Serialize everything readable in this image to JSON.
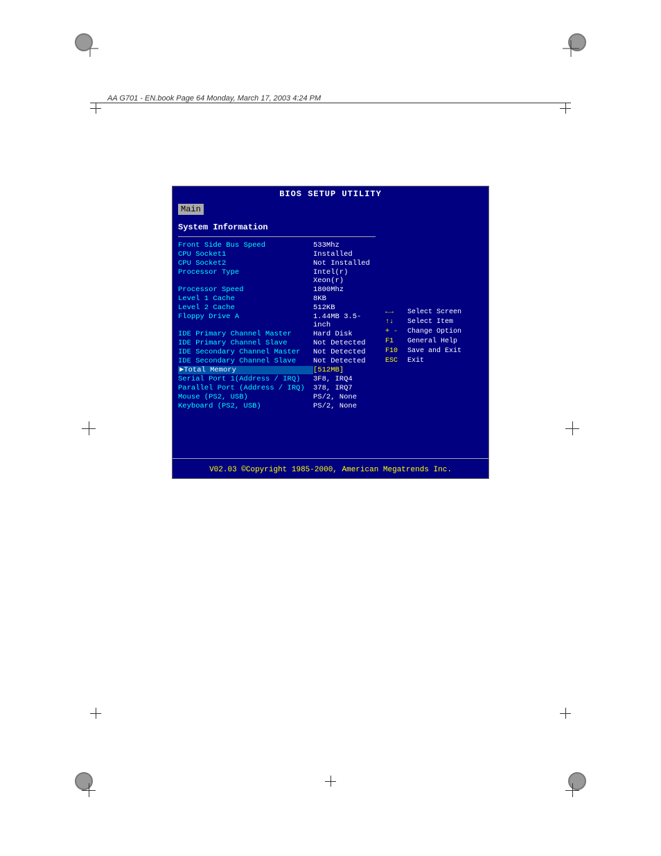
{
  "page": {
    "header_text": "AA G701 - EN.book  Page 64  Monday, March 17, 2003  4:24 PM"
  },
  "bios": {
    "title": "BIOS SETUP UTILITY",
    "menu_items": [
      "Main"
    ],
    "active_menu": "Main",
    "section_title": "System Information",
    "rows": [
      {
        "label": "Front Side Bus Speed",
        "value": "533Mhz"
      },
      {
        "label": "CPU Socket1",
        "value": "Installed"
      },
      {
        "label": "CPU Socket2",
        "value": "Not Installed"
      },
      {
        "label": "Processor Type",
        "value": "Intel(r)   Xeon(r)"
      },
      {
        "label": "Processor Speed",
        "value": "1800Mhz"
      },
      {
        "label": "Level 1 Cache",
        "value": "8KB"
      },
      {
        "label": "Level 2 Cache",
        "value": "512KB"
      },
      {
        "label": "Floppy Drive A",
        "value": "1.44MB   3.5-inch"
      },
      {
        "label": "IDE Primary Channel Master",
        "value": "Hard Disk"
      },
      {
        "label": "IDE Primary Channel Slave",
        "value": "Not Detected"
      },
      {
        "label": "IDE Secondary Channel Master",
        "value": "Not Detected"
      },
      {
        "label": "IDE Secondary Channel Slave",
        "value": "Not Detected"
      },
      {
        "label": "►Total Memory",
        "value": "[512MB]",
        "highlight": true
      },
      {
        "label": "Serial Port 1(Address / IRQ)",
        "value": "3F8, IRQ4"
      },
      {
        "label": "Parallel Port (Address / IRQ)",
        "value": "378, IRQ7"
      },
      {
        "label": "Mouse   (PS2, USB)",
        "value": "PS/2,  None"
      },
      {
        "label": "Keyboard   (PS2, USB)",
        "value": "PS/2,  None"
      }
    ],
    "help": [
      {
        "key": "←→",
        "desc": "Select Screen"
      },
      {
        "key": "↑↓",
        "desc": "Select Item"
      },
      {
        "key": "+ -",
        "desc": "Change Option"
      },
      {
        "key": "F1",
        "desc": "General Help"
      },
      {
        "key": "F10",
        "desc": "Save and Exit"
      },
      {
        "key": "ESC",
        "desc": "Exit"
      }
    ],
    "footer": "V02.03 ©Copyright 1985-2000, American Megatrends Inc."
  }
}
